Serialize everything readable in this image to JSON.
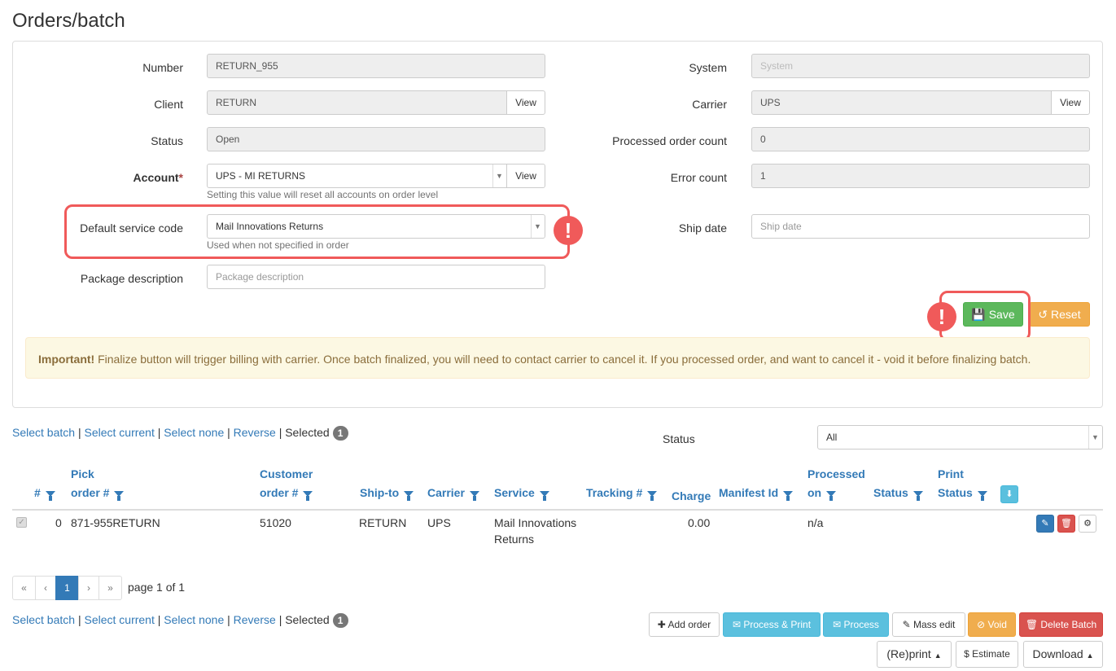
{
  "page": {
    "title": "Orders/batch"
  },
  "form": {
    "number_label": "Number",
    "number_value": "RETURN_955",
    "client_label": "Client",
    "client_value": "RETURN",
    "client_view": "View",
    "status_label": "Status",
    "status_value": "Open",
    "account_label": "Account",
    "account_required": "*",
    "account_value": "UPS - MI RETURNS",
    "account_view": "View",
    "account_help": "Setting this value will reset all accounts on order level",
    "service_label": "Default service code",
    "service_value": "Mail Innovations Returns",
    "service_help": "Used when not specified in order",
    "package_label": "Package description",
    "package_placeholder": "Package description",
    "system_label": "System",
    "system_placeholder": "System",
    "carrier_label": "Carrier",
    "carrier_value": "UPS",
    "carrier_view": "View",
    "processed_label": "Processed order count",
    "processed_value": "0",
    "error_label": "Error count",
    "error_value": "1",
    "ship_label": "Ship date",
    "ship_placeholder": "Ship date",
    "save": "Save",
    "reset": "Reset",
    "warn_mark": "!"
  },
  "alert": {
    "strong": "Important!",
    "text": " Finalize button will trigger billing with carrier. Once batch finalized, you will need to contact carrier to cancel it. If you processed order, and want to cancel it - void it before finalizing batch."
  },
  "selection": {
    "select_batch": "Select batch",
    "select_current": "Select current",
    "select_none": "Select none",
    "reverse": "Reverse",
    "selected": "Selected",
    "count": "1",
    "sep": "|"
  },
  "status_filter": {
    "label": "Status",
    "value": "All"
  },
  "table": {
    "headers": {
      "num": "#",
      "pick_1": "Pick",
      "pick_2": "order #",
      "cust_1": "Customer",
      "cust_2": "order #",
      "shipto": "Ship-to",
      "carrier": "Carrier",
      "service": "Service",
      "tracking": "Tracking #",
      "charge": "Charge",
      "manifest": "Manifest Id",
      "proc_1": "Processed",
      "proc_2": "on",
      "status": "Status",
      "print_1": "Print",
      "print_2": "Status"
    },
    "rows": [
      {
        "num": "0",
        "pick": "871-955RETURN",
        "customer": "51020",
        "shipto": "RETURN",
        "carrier": "UPS",
        "service_1": "Mail Innovations",
        "service_2": "Returns",
        "charge": "0.00",
        "processed": "n/a"
      }
    ]
  },
  "pagination": {
    "first": "«",
    "prev": "‹",
    "current": "1",
    "next": "›",
    "last": "»",
    "text": "page 1 of 1"
  },
  "actions": {
    "add_order": "Add order",
    "process_print": "Process & Print",
    "process": "Process",
    "mass_edit": "Mass edit",
    "void": "Void",
    "delete_batch": "Delete Batch",
    "reprint": "(Re)print",
    "estimate": "$ Estimate",
    "download": "Download"
  },
  "colors": {
    "primary": "#337ab7",
    "success": "#5cb85c",
    "warning": "#f0ad4e",
    "info": "#5bc0de",
    "danger": "#d9534f",
    "highlight": "#f05a5a"
  }
}
